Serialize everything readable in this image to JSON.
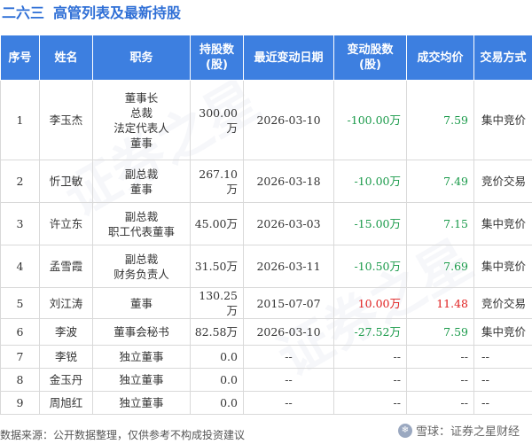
{
  "title": {
    "company": "二六三",
    "subtitle": "高管列表及最新持股"
  },
  "headers": [
    "序号",
    "姓名",
    "职务",
    "持股数\n(股)",
    "最近变动日期",
    "变动股数\n(股)",
    "成交均价",
    "交易方式"
  ],
  "rows": [
    {
      "idx": "1",
      "name": "李玉杰",
      "roles": [
        "董事长",
        "总裁",
        "法定代表人",
        "董事"
      ],
      "shares": "300.00万",
      "date": "2026-03-10",
      "change": "-100.00万",
      "price": "7.59",
      "method": "集中竞价",
      "dir": "neg"
    },
    {
      "idx": "2",
      "name": "忻卫敏",
      "roles": [
        "副总裁",
        "董事"
      ],
      "shares": "267.10万",
      "date": "2026-03-18",
      "change": "-10.00万",
      "price": "7.49",
      "method": "竞价交易",
      "dir": "neg"
    },
    {
      "idx": "3",
      "name": "许立东",
      "roles": [
        "副总裁",
        "职工代表董事"
      ],
      "shares": "45.00万",
      "date": "2026-03-03",
      "change": "-15.00万",
      "price": "7.15",
      "method": "集中竞价",
      "dir": "neg"
    },
    {
      "idx": "4",
      "name": "孟雪霞",
      "roles": [
        "副总裁",
        "财务负责人"
      ],
      "shares": "31.50万",
      "date": "2026-03-11",
      "change": "-10.50万",
      "price": "7.69",
      "method": "集中竞价",
      "dir": "neg"
    },
    {
      "idx": "5",
      "name": "刘江涛",
      "roles": [
        "董事"
      ],
      "shares": "130.25万",
      "date": "2015-07-07",
      "change": "10.00万",
      "price": "11.48",
      "method": "竞价交易",
      "dir": "pos"
    },
    {
      "idx": "6",
      "name": "李波",
      "roles": [
        "董事会秘书"
      ],
      "shares": "82.58万",
      "date": "2026-03-10",
      "change": "-27.52万",
      "price": "7.59",
      "method": "集中竞价",
      "dir": "neg"
    },
    {
      "idx": "7",
      "name": "李锐",
      "roles": [
        "独立董事"
      ],
      "shares": "0.0",
      "date": "--",
      "change": "--",
      "price": "--",
      "method": "--",
      "dir": "none"
    },
    {
      "idx": "8",
      "name": "金玉丹",
      "roles": [
        "独立董事"
      ],
      "shares": "0.0",
      "date": "--",
      "change": "--",
      "price": "--",
      "method": "--",
      "dir": "none"
    },
    {
      "idx": "9",
      "name": "周旭红",
      "roles": [
        "独立董事"
      ],
      "shares": "0.0",
      "date": "--",
      "change": "--",
      "price": "--",
      "method": "--",
      "dir": "none"
    }
  ],
  "footer": {
    "source": "数据来源：公开数据整理，仅供参考不构成投资建议"
  },
  "brand": {
    "text": "雪球：证券之星财经",
    "watermark": "证券之星"
  },
  "colors": {
    "header_bg": "#3d7fe0",
    "title": "#2f6fd6",
    "negative": "#1a9a4a",
    "positive": "#e02020"
  }
}
